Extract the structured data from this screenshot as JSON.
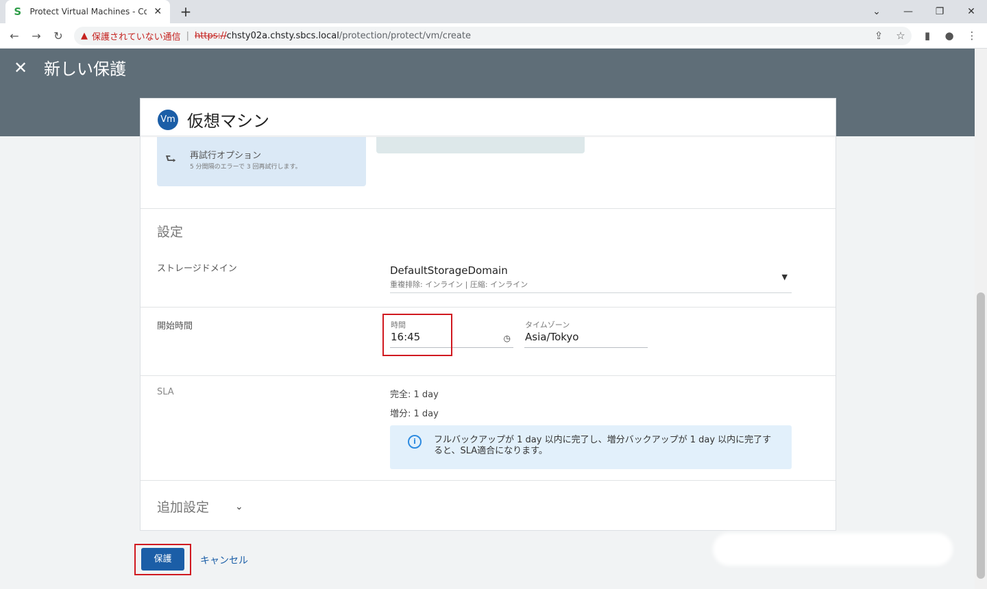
{
  "browser": {
    "tab_title": "Protect Virtual Machines - Cohesity",
    "tab_favicon": "S",
    "new_tab": "+",
    "security_warning": "保護されていない通信",
    "url_protocol": "https://",
    "url_host": "chsty02a.chsty.sbcs.local",
    "url_path": "/protection/protect/vm/create"
  },
  "header": {
    "close_glyph": "✕",
    "title": "新しい保護"
  },
  "card": {
    "badge": "Vm",
    "title": "仮想マシン"
  },
  "retry": {
    "title": "再試行オプション",
    "subtitle": "5 分間隔のエラーで 3 回再試行します。"
  },
  "settings": {
    "section_title": "設定",
    "storage_label": "ストレージドメイン",
    "storage_value": "DefaultStorageDomain",
    "storage_sub": "重複排除: インライン | 圧縮: インライン",
    "start_time_label": "開始時間",
    "time_label": "時間",
    "time_value": "16:45",
    "tz_label": "タイムゾーン",
    "tz_value": "Asia/Tokyo"
  },
  "sla": {
    "label": "SLA",
    "full": "完全: 1 day",
    "incremental": "増分: 1 day",
    "info": "フルバックアップが 1 day 以内に完了し、増分バックアップが 1 day 以内に完了すると、SLA適合になります。"
  },
  "additional": {
    "title": "追加設定"
  },
  "footer": {
    "protect_button": "保護",
    "cancel_link": "キャンセル"
  },
  "colors": {
    "header_bg": "#5f6e78",
    "primary": "#1b5ea7",
    "highlight": "#d0181f",
    "info_bg": "#e2f0fb"
  }
}
